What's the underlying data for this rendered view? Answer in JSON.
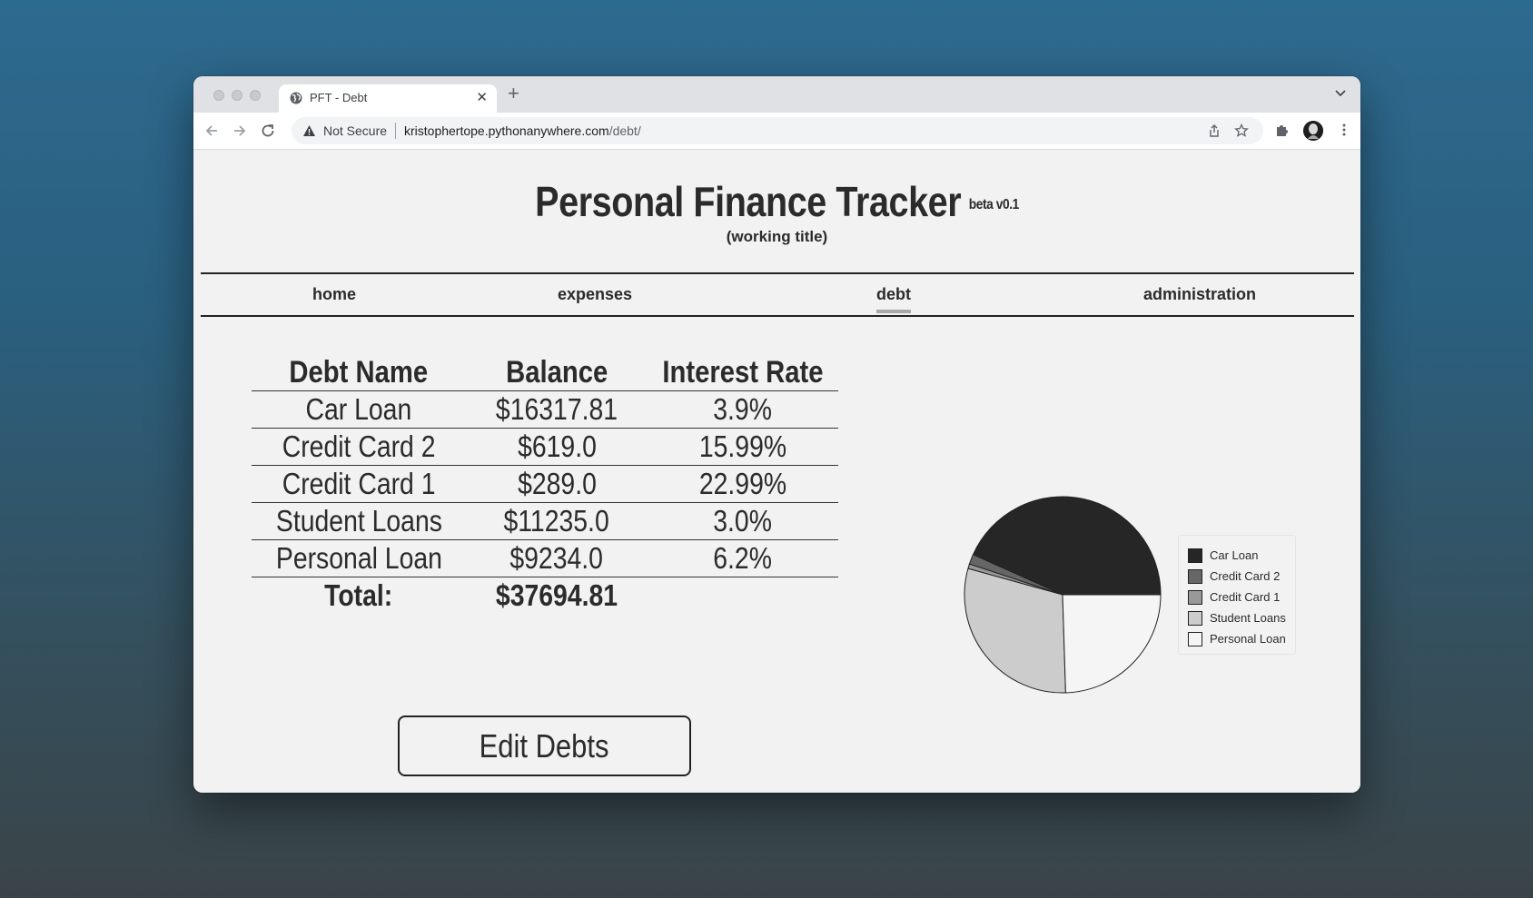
{
  "browser": {
    "tab_title": "PFT - Debt",
    "new_tab_label": "+",
    "security_label": "Not Secure",
    "url_host": "kristophertope.pythonanywhere.com",
    "url_path": "/debt/"
  },
  "site": {
    "title": "Personal Finance Tracker",
    "beta": "beta v0.1",
    "subtitle": "(working title)"
  },
  "nav": {
    "home": "home",
    "expenses": "expenses",
    "debt": "debt",
    "administration": "administration",
    "active": "debt"
  },
  "table": {
    "headers": [
      "Debt Name",
      "Balance",
      "Interest Rate"
    ],
    "rows": [
      {
        "name": "Car Loan",
        "balance": "$16317.81",
        "rate": "3.9%"
      },
      {
        "name": "Credit Card 2",
        "balance": "$619.0",
        "rate": "15.99%"
      },
      {
        "name": "Credit Card 1",
        "balance": "$289.0",
        "rate": "22.99%"
      },
      {
        "name": "Student Loans",
        "balance": "$11235.0",
        "rate": "3.0%"
      },
      {
        "name": "Personal Loan",
        "balance": "$9234.0",
        "rate": "6.2%"
      }
    ],
    "total_label": "Total:",
    "total_value": "$37694.81"
  },
  "edit_button": "Edit Debts",
  "chart_data": {
    "type": "pie",
    "categories": [
      "Car Loan",
      "Credit Card 2",
      "Credit Card 1",
      "Student Loans",
      "Personal Loan"
    ],
    "values": [
      16317.81,
      619.0,
      289.0,
      11235.0,
      9234.0
    ],
    "colors": [
      "#262626",
      "#666666",
      "#999999",
      "#cccccc",
      "#f5f5f5"
    ],
    "legend": [
      "Car Loan",
      "Credit Card 2",
      "Credit Card 1",
      "Student Loans",
      "Personal Loan"
    ],
    "legend_position": "right"
  }
}
